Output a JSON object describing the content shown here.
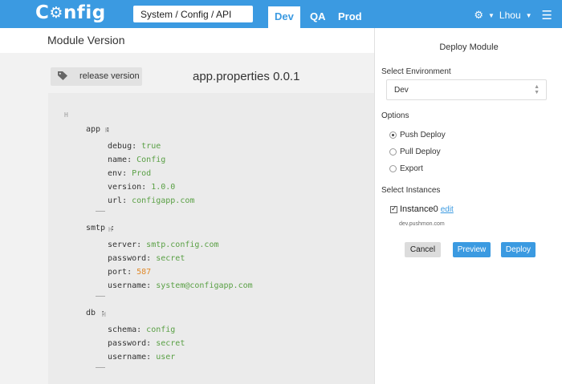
{
  "app": {
    "logo_text": "Config",
    "brand_color": "#3b9ae1"
  },
  "header": {
    "breadcrumb": "System / Config / API",
    "env_tabs": [
      {
        "label": "Dev",
        "active": true
      },
      {
        "label": "QA",
        "active": false
      },
      {
        "label": "Prod",
        "active": false
      }
    ],
    "user": "Lhou",
    "icons": [
      "gear-icon",
      "caret-down-icon",
      "hamburger-menu-icon"
    ]
  },
  "main": {
    "title": "Module Version",
    "tag_button": "release version",
    "file_title": "app.properties 0.0.1",
    "fold_marker": "H",
    "yaml": {
      "app": {
        "key": "app",
        "entries": [
          {
            "key": "debug",
            "value": "true",
            "kind": "str"
          },
          {
            "key": "name",
            "value": "Config",
            "kind": "str"
          },
          {
            "key": "env",
            "value": "Prod",
            "kind": "str"
          },
          {
            "key": "version",
            "value": "1.0.0",
            "kind": "str"
          },
          {
            "key": "url",
            "value": "configapp.com",
            "kind": "str"
          }
        ]
      },
      "smtp": {
        "key": "smtp",
        "entries": [
          {
            "key": "server",
            "value": "smtp.config.com",
            "kind": "str"
          },
          {
            "key": "password",
            "value": "secret",
            "kind": "str"
          },
          {
            "key": "port",
            "value": "587",
            "kind": "num"
          },
          {
            "key": "username",
            "value": "system@configapp.com",
            "kind": "str"
          }
        ]
      },
      "db": {
        "key": "db",
        "entries": [
          {
            "key": "schema",
            "value": "config",
            "kind": "str"
          },
          {
            "key": "password",
            "value": "secret",
            "kind": "str"
          },
          {
            "key": "username",
            "value": "user",
            "kind": "str"
          }
        ]
      }
    }
  },
  "panel": {
    "title": "Deploy Module",
    "env_label": "Select Environment",
    "env_value": "Dev",
    "options_label": "Options",
    "options": [
      {
        "label": "Push Deploy",
        "selected": true
      },
      {
        "label": "Pull Deploy",
        "selected": false
      },
      {
        "label": "Export",
        "selected": false
      }
    ],
    "instances_label": "Select Instances",
    "instance": {
      "name": "Instance0",
      "edit_label": "edit",
      "host": "dev.pushmon.com",
      "checked": true
    },
    "buttons": {
      "cancel": "Cancel",
      "preview": "Preview",
      "deploy": "Deploy"
    }
  }
}
